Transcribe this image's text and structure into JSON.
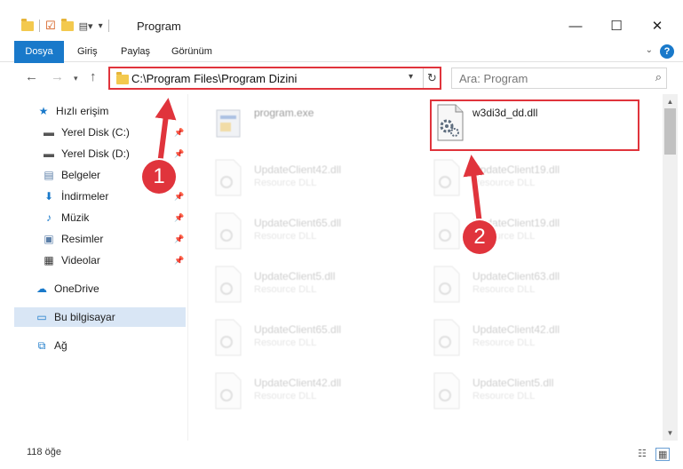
{
  "window": {
    "title": "Program",
    "minimize": "—",
    "maximize": "☐",
    "close": "✕"
  },
  "ribbon": {
    "tabs": [
      "Dosya",
      "Giriş",
      "Paylaş",
      "Görünüm"
    ],
    "help": "?"
  },
  "address": {
    "path": "C:\\Program Files\\Program Dizini"
  },
  "search": {
    "placeholder": "Ara: Program"
  },
  "sidebar": {
    "items": [
      {
        "label": "Hızlı erişim"
      },
      {
        "label": "Yerel Disk (C:)"
      },
      {
        "label": "Yerel Disk (D:)"
      },
      {
        "label": "Belgeler"
      },
      {
        "label": "İndirmeler"
      },
      {
        "label": "Müzik"
      },
      {
        "label": "Resimler"
      },
      {
        "label": "Videolar"
      },
      {
        "label": "OneDrive"
      },
      {
        "label": "Bu bilgisayar"
      },
      {
        "label": "Ağ"
      }
    ]
  },
  "files": {
    "program_exe": {
      "name": "program.exe"
    },
    "highlight": {
      "name": "w3di3d_dd.dll"
    },
    "list": [
      {
        "name": "UpdateClient42.dll",
        "type": "Resource DLL"
      },
      {
        "name": "UpdateClient19.dll",
        "type": "Resource DLL"
      },
      {
        "name": "UpdateClient65.dll",
        "type": "Resource DLL"
      },
      {
        "name": "UpdateClient19.dll",
        "type": "Resource DLL"
      },
      {
        "name": "UpdateClient5.dll",
        "type": "Resource DLL"
      },
      {
        "name": "UpdateClient63.dll",
        "type": "Resource DLL"
      },
      {
        "name": "UpdateClient65.dll",
        "type": "Resource DLL"
      },
      {
        "name": "UpdateClient42.dll",
        "type": "Resource DLL"
      },
      {
        "name": "UpdateClient42.dll",
        "type": "Resource DLL"
      },
      {
        "name": "UpdateClient5.dll",
        "type": "Resource DLL"
      }
    ]
  },
  "status": {
    "count": "118 öğe"
  },
  "annotations": {
    "badge1": "1",
    "badge2": "2"
  },
  "colors": {
    "accent": "#1979ca",
    "annotation": "#e0343c",
    "selection": "#d9e6f5"
  }
}
